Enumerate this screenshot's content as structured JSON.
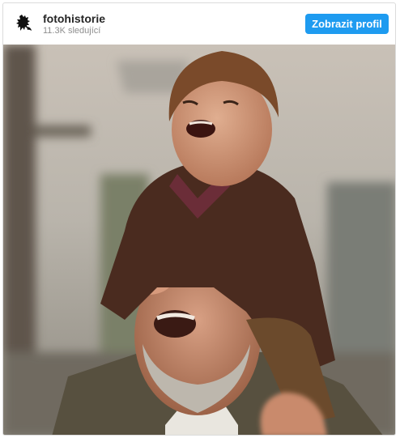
{
  "account": {
    "name": "fotohistorie",
    "followers": "11.3K sledující",
    "avatar_icon": "heraldic-lion-icon"
  },
  "actions": {
    "view_profile_label": "Zobrazit profil"
  },
  "post": {
    "image_subject": "photograph"
  },
  "colors": {
    "button": "#1e9bf0",
    "border": "#dbdbdb",
    "name_text": "#262626",
    "secondary_text": "#8e8e8e"
  }
}
